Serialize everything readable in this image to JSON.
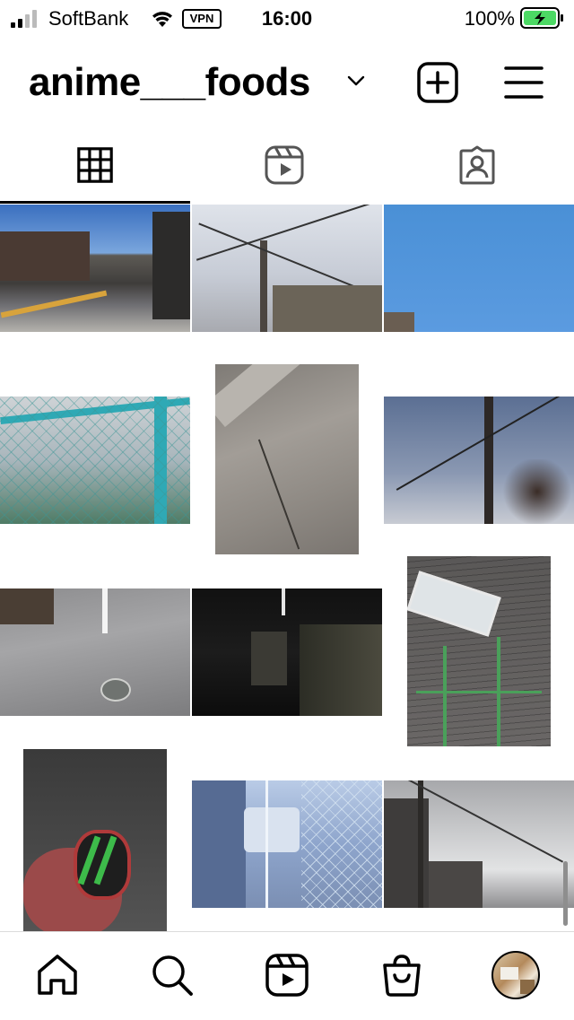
{
  "status_bar": {
    "carrier": "SoftBank",
    "vpn": "VPN",
    "time": "16:00",
    "battery_percent": "100%",
    "battery_color": "#4cd964"
  },
  "header": {
    "username": "anime___foods",
    "icons": [
      "chevron-down-icon",
      "add-post-icon",
      "menu-icon"
    ]
  },
  "tabs": [
    {
      "name": "posts-grid",
      "icon": "grid-icon",
      "selected": true
    },
    {
      "name": "reels",
      "icon": "reels-icon",
      "selected": false
    },
    {
      "name": "tagged",
      "icon": "tagged-person-icon",
      "selected": false
    }
  ],
  "bottom_nav": [
    {
      "name": "home",
      "icon": "home-icon"
    },
    {
      "name": "search",
      "icon": "search-icon"
    },
    {
      "name": "reels",
      "icon": "reels-icon"
    },
    {
      "name": "shop",
      "icon": "shop-bag-icon"
    },
    {
      "name": "profile",
      "icon": "profile-avatar"
    }
  ],
  "colors": {
    "background": "#ffffff",
    "text": "#000000",
    "divider": "#dbdbdb",
    "scrollbar": "#8e8e8e"
  }
}
